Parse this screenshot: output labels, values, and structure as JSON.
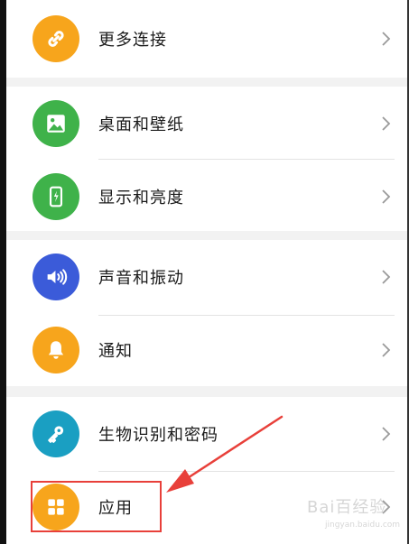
{
  "settings_groups": [
    {
      "items": [
        {
          "label": "更多连接",
          "icon": "link-icon",
          "color": "#f7a51c"
        }
      ]
    },
    {
      "items": [
        {
          "label": "桌面和壁纸",
          "icon": "image-icon",
          "color": "#3fb24a"
        },
        {
          "label": "显示和亮度",
          "icon": "phone-brightness-icon",
          "color": "#3fb24a"
        }
      ]
    },
    {
      "items": [
        {
          "label": "声音和振动",
          "icon": "speaker-icon",
          "color": "#3b5bd9"
        },
        {
          "label": "通知",
          "icon": "bell-icon",
          "color": "#f7a51c"
        }
      ]
    },
    {
      "items": [
        {
          "label": "生物识别和密码",
          "icon": "key-icon",
          "color": "#1a9fc2"
        },
        {
          "label": "应用",
          "icon": "apps-grid-icon",
          "color": "#f7a51c"
        }
      ]
    }
  ],
  "annotation": {
    "highlight_color": "#e8403a"
  },
  "watermark": {
    "text": "Bai百经验",
    "sub": "jingyan.baidu.com"
  }
}
